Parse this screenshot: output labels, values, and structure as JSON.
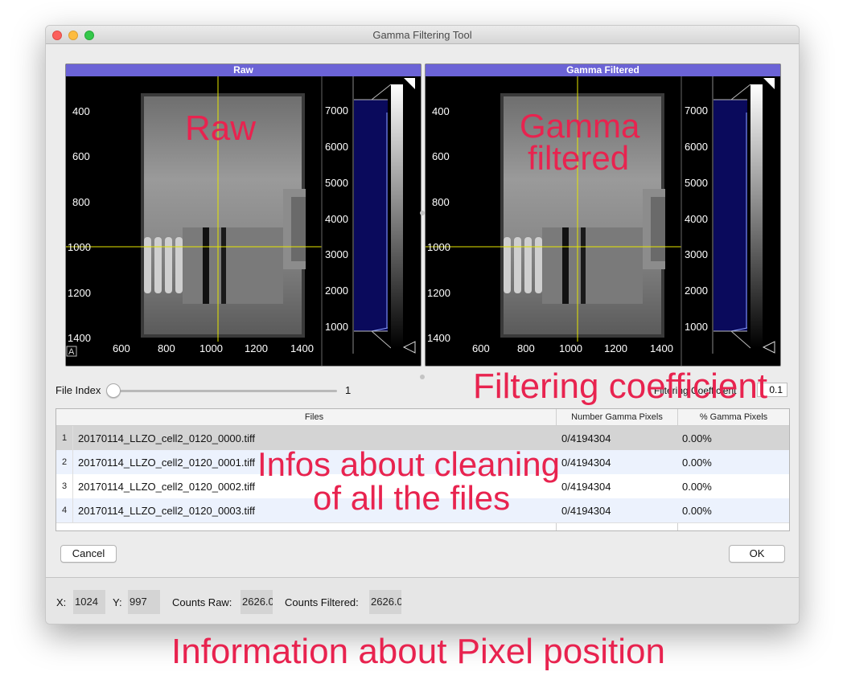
{
  "window": {
    "title": "Gamma Filtering Tool"
  },
  "raw_panel": {
    "header": "Raw",
    "y_ticks": [
      "400",
      "600",
      "800",
      "1000",
      "1200",
      "1400"
    ],
    "x_ticks": [
      "600",
      "800",
      "1000",
      "1200",
      "1400"
    ],
    "colorbar_ticks": [
      "7000",
      "6000",
      "5000",
      "4000",
      "3000",
      "2000",
      "1000"
    ],
    "corner_label": "A"
  },
  "filtered_panel": {
    "header": "Gamma Filtered",
    "y_ticks": [
      "400",
      "600",
      "800",
      "1000",
      "1200",
      "1400"
    ],
    "x_ticks": [
      "600",
      "800",
      "1000",
      "1200",
      "1400"
    ],
    "colorbar_ticks": [
      "7000",
      "6000",
      "5000",
      "4000",
      "3000",
      "2000",
      "1000"
    ]
  },
  "controls": {
    "file_index_label": "File Index",
    "file_index_value": "1",
    "filtering_coefficient_label": "Filtering Coefficient",
    "filtering_coefficient_value": "0.1"
  },
  "table": {
    "headers": [
      "Files",
      "Number Gamma Pixels",
      "% Gamma Pixels"
    ],
    "rows": [
      {
        "num": "1",
        "file": "20170114_LLZO_cell2_0120_0000.tiff",
        "count": "0/4194304",
        "pct": "0.00%"
      },
      {
        "num": "2",
        "file": "20170114_LLZO_cell2_0120_0001.tiff",
        "count": "0/4194304",
        "pct": "0.00%"
      },
      {
        "num": "3",
        "file": "20170114_LLZO_cell2_0120_0002.tiff",
        "count": "0/4194304",
        "pct": "0.00%"
      },
      {
        "num": "4",
        "file": "20170114_LLZO_cell2_0120_0003.tiff",
        "count": "0/4194304",
        "pct": "0.00%"
      }
    ]
  },
  "buttons": {
    "cancel": "Cancel",
    "ok": "OK"
  },
  "status": {
    "x_label": "X:",
    "x_value": "1024",
    "y_label": "Y:",
    "y_value": "997",
    "counts_raw_label": "Counts Raw:",
    "counts_raw_value": "2626.0",
    "counts_filtered_label": "Counts Filtered:",
    "counts_filtered_value": "2626.0"
  },
  "annotations": {
    "raw": "Raw",
    "gamma_line1": "Gamma",
    "gamma_line2": "filtered",
    "filtering": "Filtering coefficient",
    "infos_line1": "Infos about cleaning",
    "infos_line2": "of all the files",
    "pixel": "Information about Pixel position"
  },
  "colors": {
    "header_bar": "#6b63d6",
    "annotation": "#e8234f",
    "crosshair": "#e6e600",
    "histogram": "#0a0a5c"
  }
}
